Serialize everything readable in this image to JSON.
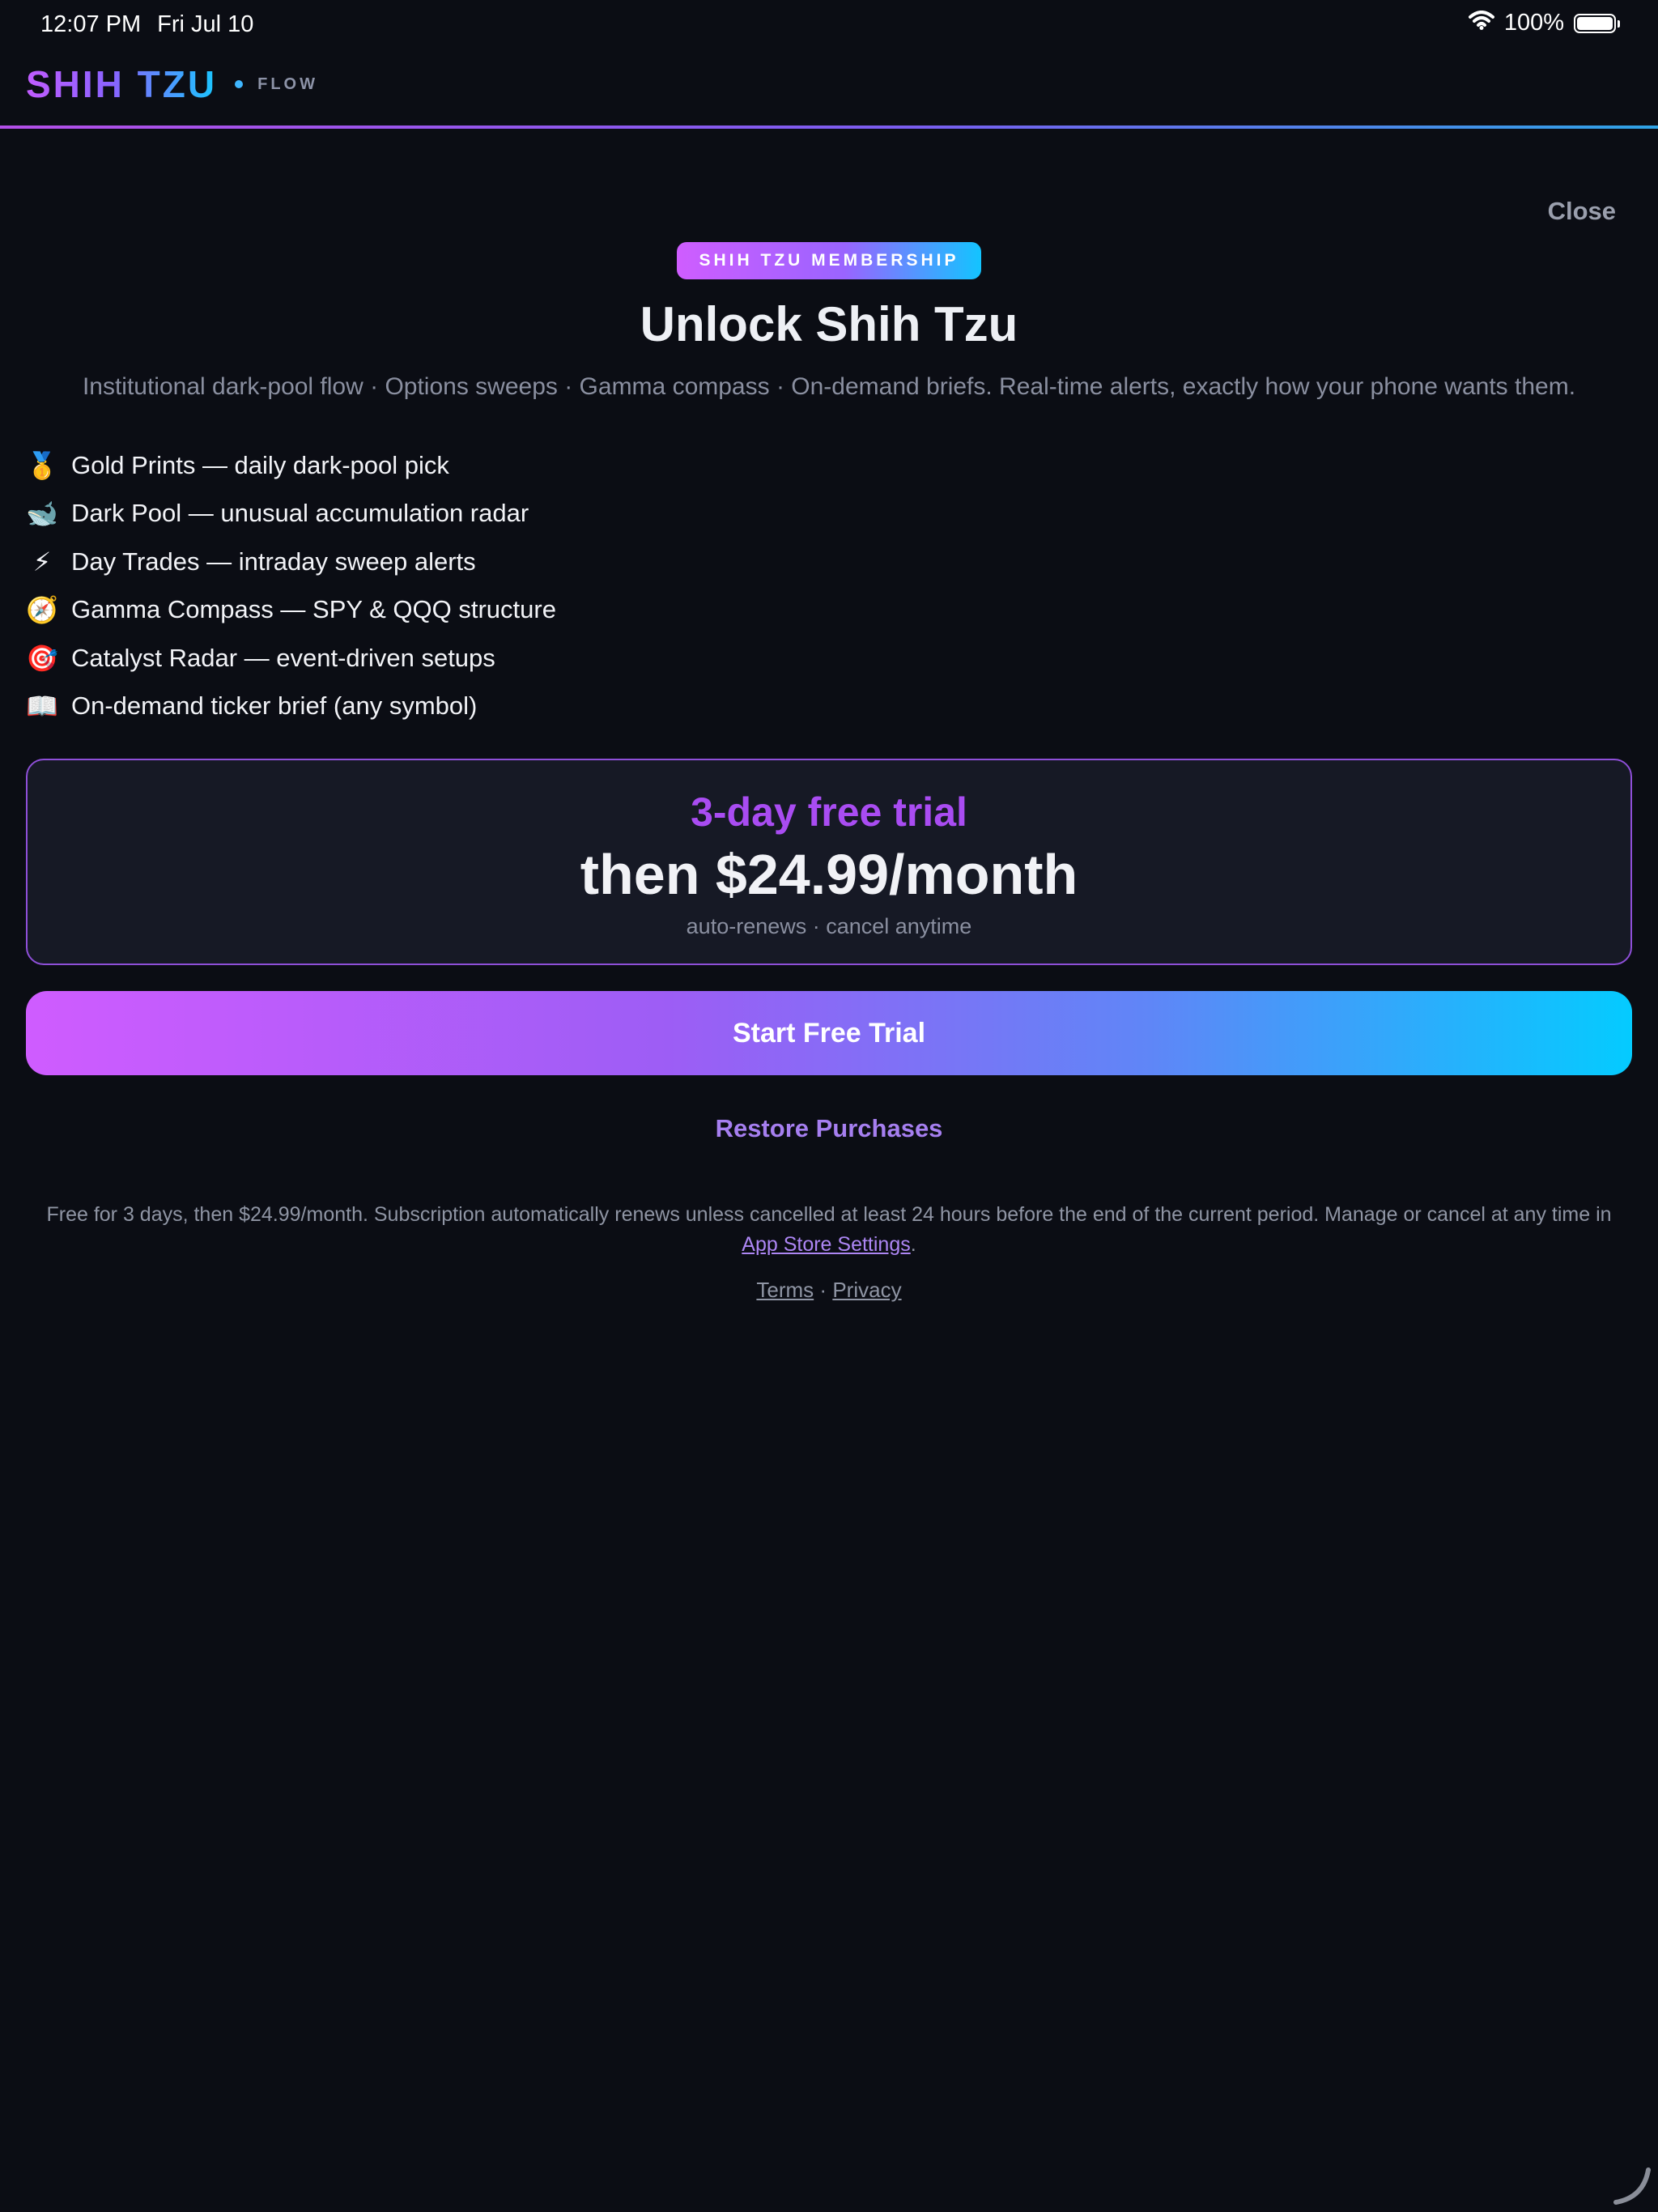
{
  "status_bar": {
    "time": "12:07 PM",
    "date": "Fri Jul 10",
    "battery": "100%",
    "battery_level": 1.0,
    "wifi_icon": "wifi-icon",
    "battery_icon": "battery-icon"
  },
  "header": {
    "brand": "SHIH TZU",
    "brand_suffix": "FLOW"
  },
  "paywall": {
    "close_label": "Close",
    "badge": "SHIH TZU MEMBERSHIP",
    "title": "Unlock Shih Tzu",
    "subtitle": "Institutional dark-pool flow · Options sweeps · Gamma compass · On-demand briefs. Real-time alerts, exactly how your phone wants them.",
    "features": [
      {
        "icon": "🥇",
        "icon_name": "gold-medal-icon",
        "text": "Gold Prints — daily dark-pool pick"
      },
      {
        "icon": "🐋",
        "icon_name": "whale-icon",
        "text": "Dark Pool — unusual accumulation radar"
      },
      {
        "icon": "⚡",
        "icon_name": "lightning-icon",
        "text": "Day Trades — intraday sweep alerts"
      },
      {
        "icon": "🧭",
        "icon_name": "compass-icon",
        "text": "Gamma Compass — SPY & QQQ structure"
      },
      {
        "icon": "🎯",
        "icon_name": "target-icon",
        "text": "Catalyst Radar — event-driven setups"
      },
      {
        "icon": "📖",
        "icon_name": "book-icon",
        "text": "On-demand ticker brief (any symbol)"
      }
    ],
    "offer": {
      "trial": "3-day free trial",
      "price": "then $24.99/month",
      "note": "auto-renews · cancel anytime"
    },
    "cta_label": "Start Free Trial",
    "restore_label": "Restore Purchases",
    "legal_text": "Free for 3 days, then $24.99/month. Subscription automatically renews unless cancelled at least 24 hours before the end of the current period. Manage or cancel at any time in",
    "legal_link": "App Store Settings",
    "legal_end": ".",
    "terms_label": "Terms",
    "links_separator": "·",
    "privacy_label": "Privacy"
  },
  "colors": {
    "background": "#0b0d14",
    "accent_purple": "#a94cf2",
    "accent_cyan": "#04cbff",
    "card_border": "#8e4fd8"
  }
}
